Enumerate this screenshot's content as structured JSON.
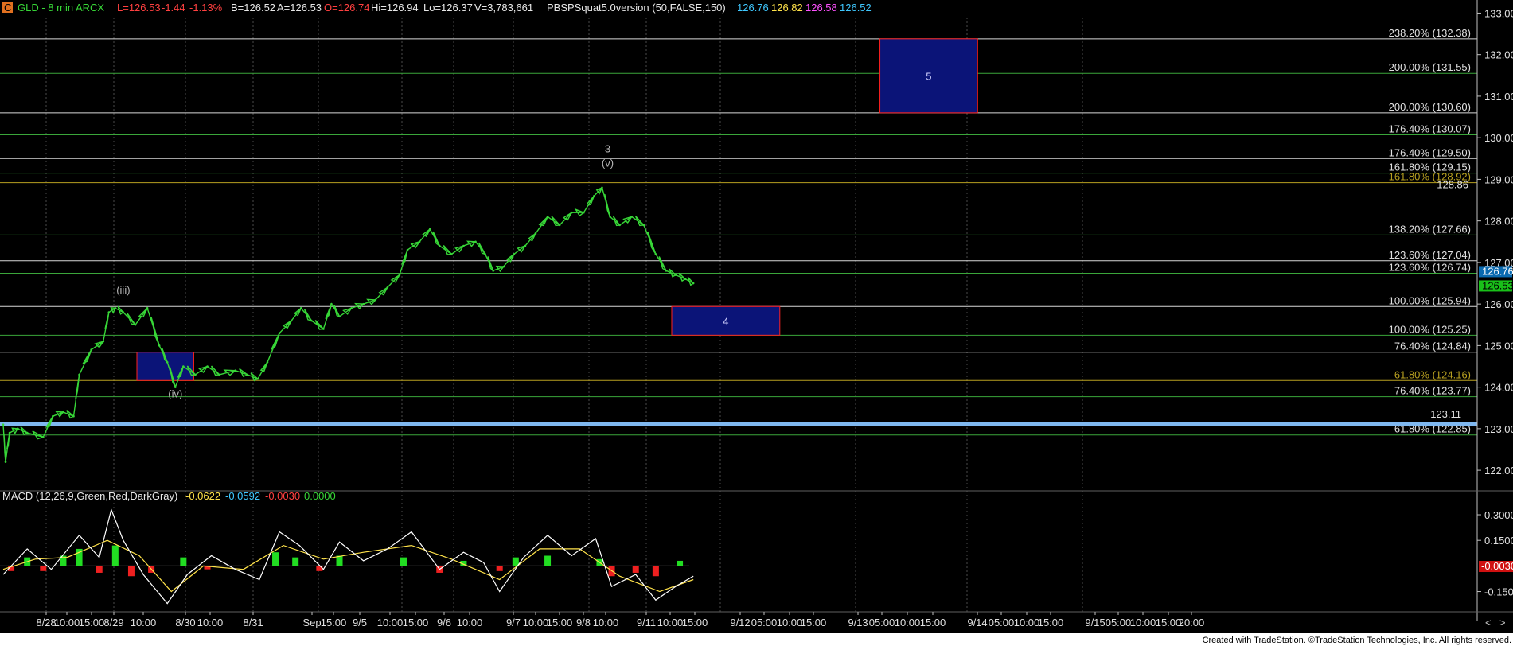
{
  "header": {
    "badge": "C",
    "symbol": "GLD - 8 min ARCX",
    "last": "L=126.53",
    "change": "-1.44",
    "change_pct": "-1.13%",
    "bid": "B=126.52",
    "ask": "A=126.53",
    "open": "O=126.74",
    "high": "Hi=126.94",
    "low": "Lo=126.37",
    "volume": "V=3,783,661",
    "study": "PBSPSquat5.0version (50,FALSE,150)",
    "study_vals": [
      {
        "text": "126.76",
        "color": "#3fc8ff"
      },
      {
        "text": "126.82",
        "color": "#ffe24a"
      },
      {
        "text": "126.58",
        "color": "#ff52ff"
      },
      {
        "text": "126.52",
        "color": "#3fc8ff"
      }
    ]
  },
  "macd_header": {
    "label": "MACD (12,26,9,Green,Red,DarkGray)",
    "v1": "-0.0622",
    "v2": "-0.0592",
    "v3": "-0.0030",
    "v4": "0.0000"
  },
  "footer": "Created with TradeStation. ©TradeStation Technologies, Inc. All rights reserved.",
  "colors": {
    "price": "#37d637",
    "macd": "#ffffff",
    "signal": "#ffe24a",
    "hist_pos": "#22dd22",
    "hist_neg": "#ee2020",
    "target_box": "#0b1478",
    "target_border": "#ff2020",
    "green_level": "#3aa63a",
    "white_level": "#d8d8d8",
    "olive_level": "#b8a020"
  },
  "chart_data": {
    "type": "line",
    "title": "GLD - 8 min ARCX",
    "ylabel": "",
    "xlabel": "",
    "ylim": [
      121.6,
      133.2
    ],
    "y_ticks": [
      "133.00",
      "132.00",
      "131.00",
      "130.00",
      "129.00",
      "128.00",
      "127.00",
      "126.00",
      "125.00",
      "124.00",
      "123.00",
      "122.00"
    ],
    "x_ticks": [
      "8/28",
      "10:00",
      "15:00",
      "8/29",
      "10:00",
      "8/30",
      "10:00",
      "8/31",
      "Sep",
      "15:00",
      "9/5",
      "10:00",
      "15:00",
      "9/6",
      "10:00",
      "9/7",
      "10:00",
      "15:00",
      "9/8",
      "10:00",
      "9/11",
      "10:00",
      "15:00",
      "9/12",
      "05:00",
      "10:00",
      "15:00",
      "9/13",
      "05:00",
      "10:00",
      "15:00",
      "9/14",
      "05:00",
      "10:00",
      "15:00",
      "9/15",
      "05:00",
      "10:00",
      "15:00",
      "20:00"
    ],
    "price_series": {
      "name": "GLD",
      "points": [
        {
          "t": 0,
          "p": 123.1
        },
        {
          "t": 3,
          "p": 122.2
        },
        {
          "t": 8,
          "p": 122.9
        },
        {
          "t": 18,
          "p": 123.0
        },
        {
          "t": 30,
          "p": 122.9
        },
        {
          "t": 50,
          "p": 122.8
        },
        {
          "t": 62,
          "p": 123.3
        },
        {
          "t": 75,
          "p": 123.4
        },
        {
          "t": 88,
          "p": 123.3
        },
        {
          "t": 95,
          "p": 124.3
        },
        {
          "t": 110,
          "p": 124.9
        },
        {
          "t": 125,
          "p": 125.1
        },
        {
          "t": 132,
          "p": 125.8
        },
        {
          "t": 140,
          "p": 125.9
        },
        {
          "t": 150,
          "p": 125.8
        },
        {
          "t": 165,
          "p": 125.5
        },
        {
          "t": 180,
          "p": 125.9
        },
        {
          "t": 195,
          "p": 125.0
        },
        {
          "t": 205,
          "p": 124.6
        },
        {
          "t": 215,
          "p": 124.0
        },
        {
          "t": 225,
          "p": 124.5
        },
        {
          "t": 240,
          "p": 124.3
        },
        {
          "t": 255,
          "p": 124.5
        },
        {
          "t": 270,
          "p": 124.3
        },
        {
          "t": 290,
          "p": 124.4
        },
        {
          "t": 305,
          "p": 124.3
        },
        {
          "t": 318,
          "p": 124.2
        },
        {
          "t": 330,
          "p": 124.6
        },
        {
          "t": 345,
          "p": 125.3
        },
        {
          "t": 360,
          "p": 125.6
        },
        {
          "t": 372,
          "p": 125.9
        },
        {
          "t": 385,
          "p": 125.6
        },
        {
          "t": 400,
          "p": 125.4
        },
        {
          "t": 410,
          "p": 126.0
        },
        {
          "t": 420,
          "p": 125.7
        },
        {
          "t": 435,
          "p": 125.9
        },
        {
          "t": 450,
          "p": 126.0
        },
        {
          "t": 465,
          "p": 126.1
        },
        {
          "t": 480,
          "p": 126.4
        },
        {
          "t": 495,
          "p": 126.7
        },
        {
          "t": 505,
          "p": 127.3
        },
        {
          "t": 520,
          "p": 127.5
        },
        {
          "t": 533,
          "p": 127.8
        },
        {
          "t": 545,
          "p": 127.4
        },
        {
          "t": 560,
          "p": 127.2
        },
        {
          "t": 575,
          "p": 127.4
        },
        {
          "t": 590,
          "p": 127.5
        },
        {
          "t": 602,
          "p": 127.2
        },
        {
          "t": 612,
          "p": 126.8
        },
        {
          "t": 625,
          "p": 126.9
        },
        {
          "t": 638,
          "p": 127.2
        },
        {
          "t": 652,
          "p": 127.4
        },
        {
          "t": 665,
          "p": 127.7
        },
        {
          "t": 680,
          "p": 128.1
        },
        {
          "t": 695,
          "p": 127.9
        },
        {
          "t": 710,
          "p": 128.2
        },
        {
          "t": 725,
          "p": 128.2
        },
        {
          "t": 738,
          "p": 128.6
        },
        {
          "t": 748,
          "p": 128.8
        },
        {
          "t": 758,
          "p": 128.1
        },
        {
          "t": 770,
          "p": 127.9
        },
        {
          "t": 785,
          "p": 128.1
        },
        {
          "t": 800,
          "p": 127.9
        },
        {
          "t": 815,
          "p": 127.2
        },
        {
          "t": 828,
          "p": 126.8
        },
        {
          "t": 840,
          "p": 126.7
        },
        {
          "t": 852,
          "p": 126.6
        },
        {
          "t": 862,
          "p": 126.5
        }
      ]
    },
    "levels": [
      {
        "label": "238.20% (132.38)",
        "value": 132.38,
        "color": "white"
      },
      {
        "label": "200.00% (131.55)",
        "value": 131.55,
        "color": "green"
      },
      {
        "label": "200.00% (130.60)",
        "value": 130.6,
        "color": "white"
      },
      {
        "label": "176.40% (130.07)",
        "value": 130.07,
        "color": "green"
      },
      {
        "label": "176.40% (129.50)",
        "value": 129.5,
        "color": "white"
      },
      {
        "label": "161.80% (129.15)",
        "value": 129.15,
        "color": "green"
      },
      {
        "label": "161.80% (128.92)",
        "value": 128.92,
        "color": "olive"
      },
      {
        "label": "138.20% (127.66)",
        "value": 127.66,
        "color": "green"
      },
      {
        "label": "123.60% (127.04)",
        "value": 127.04,
        "color": "white"
      },
      {
        "label": "123.60% (126.74)",
        "value": 126.74,
        "color": "green"
      },
      {
        "label": "100.00% (125.94)",
        "value": 125.94,
        "color": "white"
      },
      {
        "label": "100.00% (125.25)",
        "value": 125.25,
        "color": "green"
      },
      {
        "label": "76.40% (124.84)",
        "value": 124.84,
        "color": "white"
      },
      {
        "label": "61.80% (124.16)",
        "value": 124.16,
        "color": "olive"
      },
      {
        "label": "76.40% (123.77)",
        "value": 123.77,
        "color": "green"
      },
      {
        "label": "61.80% (122.85)",
        "value": 122.85,
        "color": "green"
      }
    ],
    "support_line": {
      "value": 123.11,
      "label": "123.11"
    },
    "high_marker": {
      "value": 128.86,
      "label": "128.86"
    },
    "wave_labels": [
      {
        "label": "(iii)",
        "t": 150,
        "p": 126.25
      },
      {
        "label": "(iv)",
        "t": 215,
        "p": 123.75
      },
      {
        "label": "3",
        "t": 755,
        "p": 129.65
      },
      {
        "label": "(v)",
        "t": 755,
        "p": 129.3
      }
    ],
    "target_boxes": [
      {
        "label": "4",
        "t1": 835,
        "t2": 970,
        "p_top": 125.94,
        "p_bot": 125.25
      },
      {
        "label": "5",
        "t1": 1095,
        "t2": 1217,
        "p_top": 132.38,
        "p_bot": 130.6
      },
      {
        "label": "",
        "t1": 167,
        "t2": 238,
        "p_top": 124.84,
        "p_bot": 124.16
      }
    ],
    "price_badges": [
      {
        "label": "126.76",
        "value": 126.76
      },
      {
        "label": "126.53",
        "value": 126.53
      }
    ],
    "macd": {
      "ylim": [
        -0.25,
        0.37
      ],
      "y_ticks": [
        "0.3000",
        "0.1500",
        "-0.1500"
      ],
      "badge": "-0.0030",
      "macd_line": [
        {
          "t": 0,
          "v": -0.05
        },
        {
          "t": 30,
          "v": 0.1
        },
        {
          "t": 60,
          "v": -0.02
        },
        {
          "t": 95,
          "v": 0.18
        },
        {
          "t": 120,
          "v": 0.05
        },
        {
          "t": 135,
          "v": 0.33
        },
        {
          "t": 150,
          "v": 0.15
        },
        {
          "t": 175,
          "v": -0.05
        },
        {
          "t": 205,
          "v": -0.22
        },
        {
          "t": 230,
          "v": -0.05
        },
        {
          "t": 260,
          "v": 0.06
        },
        {
          "t": 290,
          "v": -0.02
        },
        {
          "t": 320,
          "v": -0.08
        },
        {
          "t": 345,
          "v": 0.2
        },
        {
          "t": 370,
          "v": 0.12
        },
        {
          "t": 400,
          "v": -0.02
        },
        {
          "t": 420,
          "v": 0.14
        },
        {
          "t": 450,
          "v": 0.03
        },
        {
          "t": 480,
          "v": 0.1
        },
        {
          "t": 510,
          "v": 0.2
        },
        {
          "t": 545,
          "v": -0.02
        },
        {
          "t": 575,
          "v": 0.08
        },
        {
          "t": 600,
          "v": 0.02
        },
        {
          "t": 620,
          "v": -0.15
        },
        {
          "t": 650,
          "v": 0.05
        },
        {
          "t": 680,
          "v": 0.18
        },
        {
          "t": 710,
          "v": 0.06
        },
        {
          "t": 740,
          "v": 0.16
        },
        {
          "t": 760,
          "v": -0.12
        },
        {
          "t": 790,
          "v": -0.05
        },
        {
          "t": 815,
          "v": -0.2
        },
        {
          "t": 840,
          "v": -0.12
        },
        {
          "t": 862,
          "v": -0.06
        }
      ],
      "signal_line": [
        {
          "t": 0,
          "v": -0.02
        },
        {
          "t": 40,
          "v": 0.04
        },
        {
          "t": 80,
          "v": 0.05
        },
        {
          "t": 130,
          "v": 0.15
        },
        {
          "t": 170,
          "v": 0.06
        },
        {
          "t": 210,
          "v": -0.15
        },
        {
          "t": 250,
          "v": 0.0
        },
        {
          "t": 300,
          "v": -0.02
        },
        {
          "t": 350,
          "v": 0.12
        },
        {
          "t": 400,
          "v": 0.04
        },
        {
          "t": 450,
          "v": 0.08
        },
        {
          "t": 510,
          "v": 0.12
        },
        {
          "t": 560,
          "v": 0.04
        },
        {
          "t": 620,
          "v": -0.08
        },
        {
          "t": 670,
          "v": 0.1
        },
        {
          "t": 720,
          "v": 0.1
        },
        {
          "t": 770,
          "v": -0.06
        },
        {
          "t": 820,
          "v": -0.15
        },
        {
          "t": 862,
          "v": -0.08
        }
      ],
      "histogram": [
        {
          "t": 10,
          "v": -0.03
        },
        {
          "t": 30,
          "v": 0.05
        },
        {
          "t": 50,
          "v": -0.03
        },
        {
          "t": 75,
          "v": 0.06
        },
        {
          "t": 95,
          "v": 0.1
        },
        {
          "t": 120,
          "v": -0.04
        },
        {
          "t": 140,
          "v": 0.12
        },
        {
          "t": 160,
          "v": -0.06
        },
        {
          "t": 185,
          "v": -0.04
        },
        {
          "t": 225,
          "v": 0.05
        },
        {
          "t": 255,
          "v": -0.02
        },
        {
          "t": 340,
          "v": 0.08
        },
        {
          "t": 365,
          "v": 0.05
        },
        {
          "t": 395,
          "v": -0.03
        },
        {
          "t": 420,
          "v": 0.06
        },
        {
          "t": 500,
          "v": 0.05
        },
        {
          "t": 545,
          "v": -0.04
        },
        {
          "t": 575,
          "v": 0.03
        },
        {
          "t": 620,
          "v": -0.03
        },
        {
          "t": 640,
          "v": 0.05
        },
        {
          "t": 680,
          "v": 0.06
        },
        {
          "t": 745,
          "v": 0.04
        },
        {
          "t": 760,
          "v": -0.06
        },
        {
          "t": 790,
          "v": -0.04
        },
        {
          "t": 815,
          "v": -0.06
        },
        {
          "t": 845,
          "v": 0.03
        }
      ]
    }
  }
}
